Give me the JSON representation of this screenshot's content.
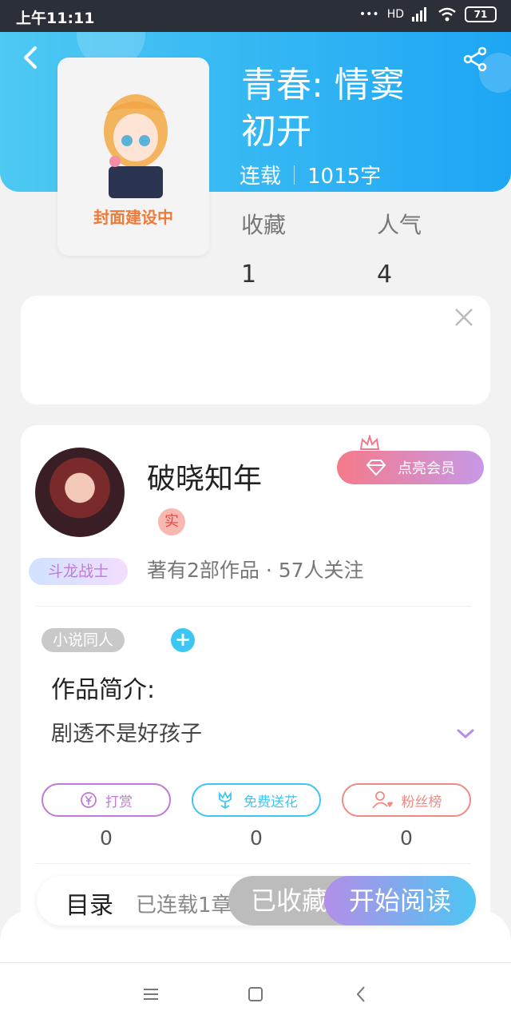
{
  "status_bar": {
    "time": "上午11:11",
    "network": "HD",
    "battery": "71"
  },
  "book": {
    "title_line1": "青春: 情窦",
    "title_line2": "初开",
    "status": "连载",
    "word_count": "1015字",
    "cover_text": "封面建设中"
  },
  "stats": [
    {
      "label": "收藏",
      "value": "1"
    },
    {
      "label": "人气",
      "value": "4"
    }
  ],
  "author": {
    "name": "破晓知年",
    "real_badge": "实",
    "title_badge": "斗龙战士",
    "meta": "著有2部作品 · 57人关注",
    "vip_label": "点亮会员"
  },
  "work": {
    "tag": "小说同人",
    "plus": "+",
    "intro_title": "作品简介:",
    "intro_text": "剧透不是好孩子"
  },
  "actions": [
    {
      "icon": "yen-icon",
      "label": "打赏",
      "value": "0",
      "color": "#c07ad8"
    },
    {
      "icon": "flower-icon",
      "label": "免费送花",
      "value": "0",
      "color": "#3ec6f2"
    },
    {
      "icon": "fans-icon",
      "label": "粉丝榜",
      "value": "0",
      "color": "#f08a84"
    }
  ],
  "bottom": {
    "toc_label": "目录",
    "toc_count": "已连载1章",
    "favorited": "已收藏",
    "start_read": "开始阅读"
  },
  "colors": {
    "header_start": "#4dc9f2",
    "header_end": "#1ea6f4",
    "accent_blue": "#3ec6f2",
    "cover_text": "#f07a38"
  }
}
